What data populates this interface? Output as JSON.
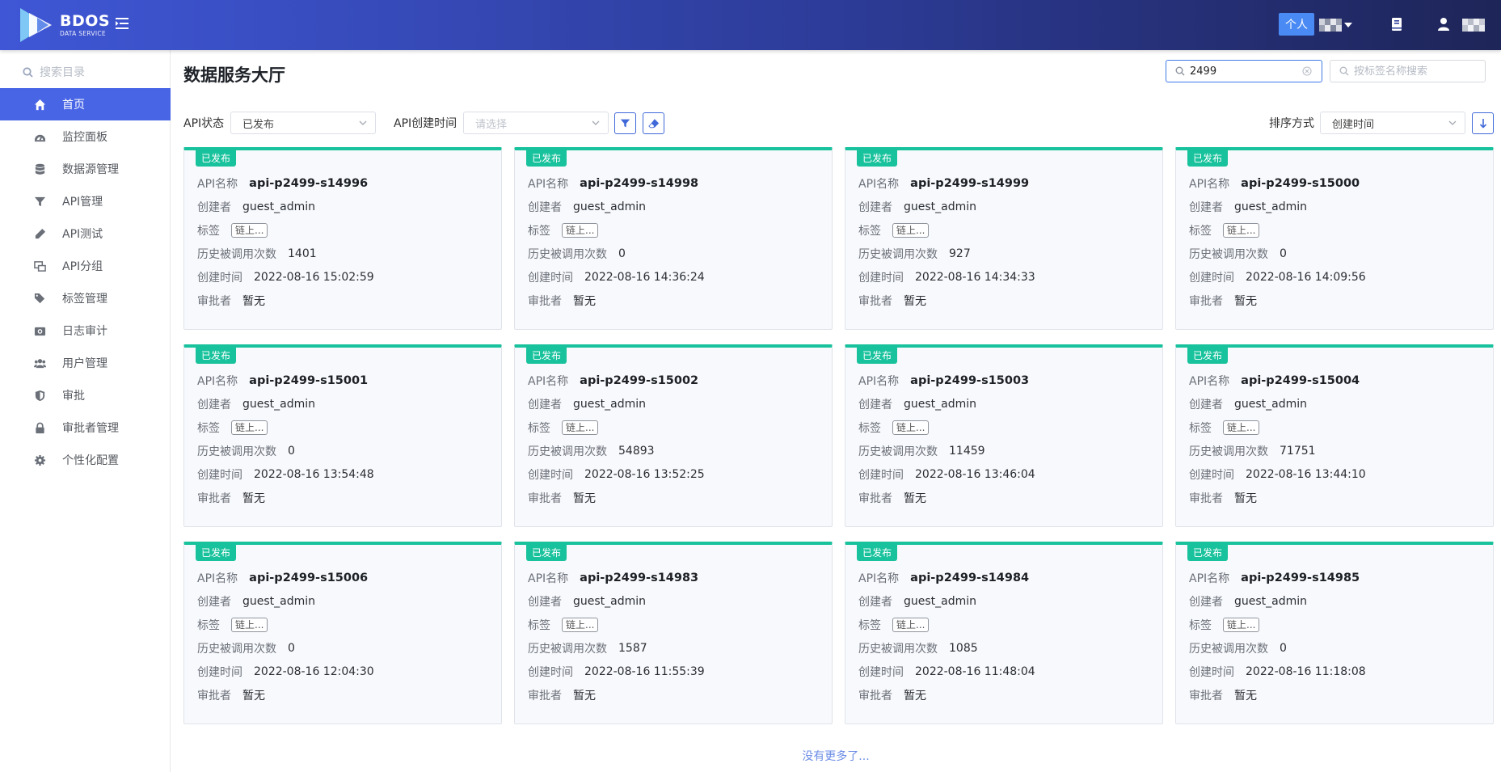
{
  "header": {
    "brand": "BDOS",
    "brand_sub": "DATA SERVICE",
    "personal_label": "个人"
  },
  "sidebar": {
    "search_placeholder": "搜索目录",
    "items": [
      {
        "label": "首页",
        "icon": "home-icon",
        "active": true
      },
      {
        "label": "监控面板",
        "icon": "dashboard-icon"
      },
      {
        "label": "数据源管理",
        "icon": "database-icon"
      },
      {
        "label": "API管理",
        "icon": "funnel-icon"
      },
      {
        "label": "API测试",
        "icon": "pen-icon"
      },
      {
        "label": "API分组",
        "icon": "group-icon"
      },
      {
        "label": "标签管理",
        "icon": "tags-icon"
      },
      {
        "label": "日志审计",
        "icon": "camera-icon"
      },
      {
        "label": "用户管理",
        "icon": "users-icon"
      },
      {
        "label": "审批",
        "icon": "shield-icon"
      },
      {
        "label": "审批者管理",
        "icon": "lock-icon"
      },
      {
        "label": "个性化配置",
        "icon": "gear-icon"
      }
    ]
  },
  "main": {
    "title": "数据服务大厅",
    "search_value": "2499",
    "tag_search_placeholder": "按标签名称搜索",
    "filters": {
      "status_label": "API状态",
      "status_value": "已发布",
      "created_label": "API创建时间",
      "created_placeholder": "请选择",
      "sort_label": "排序方式",
      "sort_value": "创建时间"
    },
    "field_labels": {
      "name": "API名称",
      "creator": "创建者",
      "tag": "标签",
      "calls": "历史被调用次数",
      "created": "创建时间",
      "approver": "审批者"
    },
    "cards": [
      {
        "status": "已发布",
        "name": "api-p2499-s14996",
        "creator": "guest_admin",
        "tag": "链上...",
        "calls": "1401",
        "created": "2022-08-16 15:02:59",
        "approver": "暂无"
      },
      {
        "status": "已发布",
        "name": "api-p2499-s14998",
        "creator": "guest_admin",
        "tag": "链上...",
        "calls": "0",
        "created": "2022-08-16 14:36:24",
        "approver": "暂无"
      },
      {
        "status": "已发布",
        "name": "api-p2499-s14999",
        "creator": "guest_admin",
        "tag": "链上...",
        "calls": "927",
        "created": "2022-08-16 14:34:33",
        "approver": "暂无"
      },
      {
        "status": "已发布",
        "name": "api-p2499-s15000",
        "creator": "guest_admin",
        "tag": "链上...",
        "calls": "0",
        "created": "2022-08-16 14:09:56",
        "approver": "暂无"
      },
      {
        "status": "已发布",
        "name": "api-p2499-s15001",
        "creator": "guest_admin",
        "tag": "链上...",
        "calls": "0",
        "created": "2022-08-16 13:54:48",
        "approver": "暂无"
      },
      {
        "status": "已发布",
        "name": "api-p2499-s15002",
        "creator": "guest_admin",
        "tag": "链上...",
        "calls": "54893",
        "created": "2022-08-16 13:52:25",
        "approver": "暂无"
      },
      {
        "status": "已发布",
        "name": "api-p2499-s15003",
        "creator": "guest_admin",
        "tag": "链上...",
        "calls": "11459",
        "created": "2022-08-16 13:46:04",
        "approver": "暂无"
      },
      {
        "status": "已发布",
        "name": "api-p2499-s15004",
        "creator": "guest_admin",
        "tag": "链上...",
        "calls": "71751",
        "created": "2022-08-16 13:44:10",
        "approver": "暂无"
      },
      {
        "status": "已发布",
        "name": "api-p2499-s15006",
        "creator": "guest_admin",
        "tag": "链上...",
        "calls": "0",
        "created": "2022-08-16 12:04:30",
        "approver": "暂无"
      },
      {
        "status": "已发布",
        "name": "api-p2499-s14983",
        "creator": "guest_admin",
        "tag": "链上...",
        "calls": "1587",
        "created": "2022-08-16 11:55:39",
        "approver": "暂无"
      },
      {
        "status": "已发布",
        "name": "api-p2499-s14984",
        "creator": "guest_admin",
        "tag": "链上...",
        "calls": "1085",
        "created": "2022-08-16 11:48:04",
        "approver": "暂无"
      },
      {
        "status": "已发布",
        "name": "api-p2499-s14985",
        "creator": "guest_admin",
        "tag": "链上...",
        "calls": "0",
        "created": "2022-08-16 11:18:08",
        "approver": "暂无"
      }
    ],
    "no_more": "没有更多了..."
  },
  "colors": {
    "accent": "#4865e6",
    "published": "#18c29c",
    "header_start": "#3f57d6",
    "header_end": "#1e2558"
  }
}
